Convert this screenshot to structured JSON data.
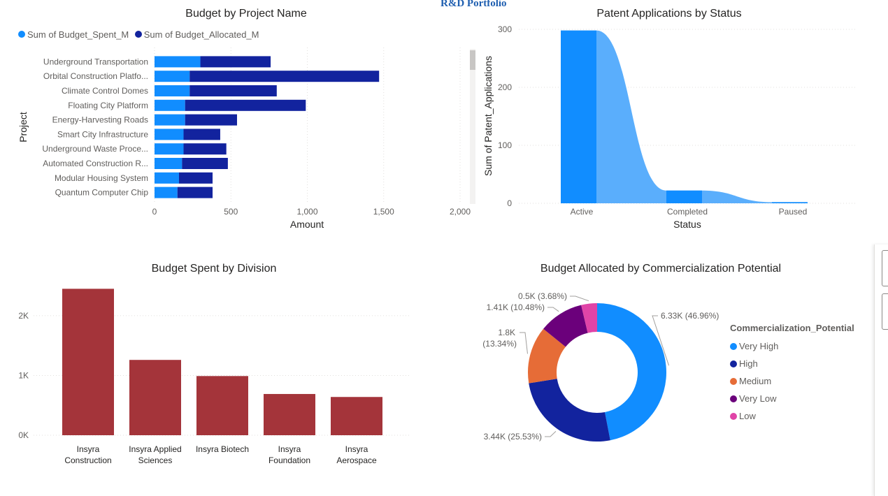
{
  "page": {
    "title": "R&D Portfolio"
  },
  "colors": {
    "spent": "#118dff",
    "allocated": "#12239e",
    "division_bar": "#a4343a",
    "very_high": "#118dff",
    "high": "#12239e",
    "medium": "#e66c37",
    "very_low": "#6b007b",
    "low": "#e044a7",
    "area_dark": "#118dff",
    "area_light": "#5aaefc"
  },
  "charts": {
    "project": {
      "title": "Budget by Project Name",
      "legend": [
        "Sum of Budget_Spent_M",
        "Sum of Budget_Allocated_M"
      ],
      "xlabel": "Amount",
      "ylabel": "Project",
      "xticks": [
        "0",
        "500",
        "1,000",
        "1,500",
        "2,000"
      ]
    },
    "patent": {
      "title": "Patent Applications by Status",
      "xlabel": "Status",
      "ylabel": "Sum of Patent_Applications",
      "yticks": [
        "0",
        "100",
        "200",
        "300"
      ]
    },
    "division": {
      "title": "Budget Spent by Division",
      "yticks": [
        "0K",
        "1K",
        "2K"
      ]
    },
    "potential": {
      "title": "Budget Allocated by Commercialization Potential",
      "legend_title": "Commercialization_Potential"
    }
  },
  "chart_data": [
    {
      "type": "bar",
      "orientation": "horizontal",
      "stacked": true,
      "title": "Budget by Project Name",
      "xlabel": "Amount",
      "ylabel": "Project",
      "xlim": [
        0,
        2000
      ],
      "categories": [
        "Underground Transportation",
        "Orbital Construction Platfo...",
        "Climate Control Domes",
        "Floating City Platform",
        "Energy-Harvesting Roads",
        "Smart City Infrastructure",
        "Underground Waste Proce...",
        "Automated Construction R...",
        "Modular Housing System",
        "Quantum Computer Chip"
      ],
      "series": [
        {
          "name": "Sum of Budget_Spent_M",
          "values": [
            300,
            230,
            230,
            200,
            200,
            190,
            190,
            180,
            160,
            150
          ]
        },
        {
          "name": "Sum of Budget_Allocated_M",
          "values": [
            460,
            1240,
            570,
            790,
            340,
            240,
            280,
            300,
            220,
            230
          ]
        }
      ],
      "legend_position": "top-left",
      "grid": true
    },
    {
      "type": "area",
      "title": "Patent Applications by Status",
      "xlabel": "Status",
      "ylabel": "Sum of Patent_Applications",
      "ylim": [
        0,
        300
      ],
      "categories": [
        "Active",
        "Completed",
        "Paused"
      ],
      "values": [
        298,
        22,
        2
      ],
      "grid": true
    },
    {
      "type": "bar",
      "title": "Budget Spent by Division",
      "categories": [
        "Insyra Construction",
        "Insyra Applied Sciences",
        "Insyra Biotech",
        "Insyra Foundation",
        "Insyra Aerospace"
      ],
      "values": [
        2450,
        1260,
        990,
        690,
        640
      ],
      "ylim": [
        0,
        2700
      ],
      "grid": true
    },
    {
      "type": "pie",
      "donut": true,
      "title": "Budget Allocated by Commercialization Potential",
      "legend_title": "Commercialization_Potential",
      "categories": [
        "Very High",
        "High",
        "Medium",
        "Very Low",
        "Low"
      ],
      "values": [
        6330,
        3440,
        1800,
        1410,
        500
      ],
      "percent": [
        46.96,
        25.53,
        13.34,
        10.48,
        3.68
      ],
      "labels": [
        "6.33K (46.96%)",
        "3.44K (25.53%)",
        "1.8K (13.34%)",
        "1.41K (10.48%)",
        "0.5K (3.68%)"
      ],
      "legend_position": "right"
    }
  ]
}
